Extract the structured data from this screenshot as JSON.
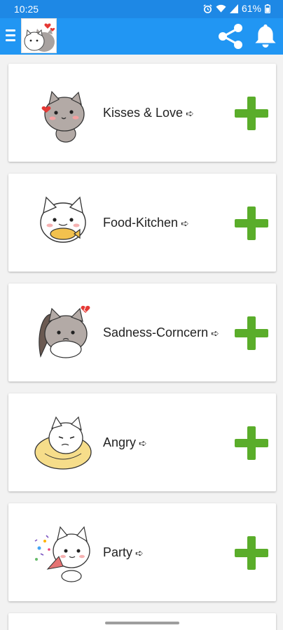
{
  "status_bar": {
    "time": "10:25",
    "battery_percent": "61%",
    "icons": [
      "alarm-icon",
      "wifi-icon",
      "signal-icon",
      "battery-icon"
    ]
  },
  "app_bar": {
    "icons": [
      "menu-icon",
      "app-logo",
      "share-icon",
      "bell-icon"
    ],
    "color": "#2196f3"
  },
  "categories": [
    {
      "label": "Kisses & Love",
      "arrow": "➪"
    },
    {
      "label": "Food-Kitchen",
      "arrow": "➪"
    },
    {
      "label": "Sadness-Corncern",
      "arrow": "➪"
    },
    {
      "label": "Angry",
      "arrow": "➪"
    },
    {
      "label": "Party",
      "arrow": "➪"
    }
  ],
  "colors": {
    "accent_green": "#5aad2a",
    "status_bar": "#1e88e5"
  }
}
